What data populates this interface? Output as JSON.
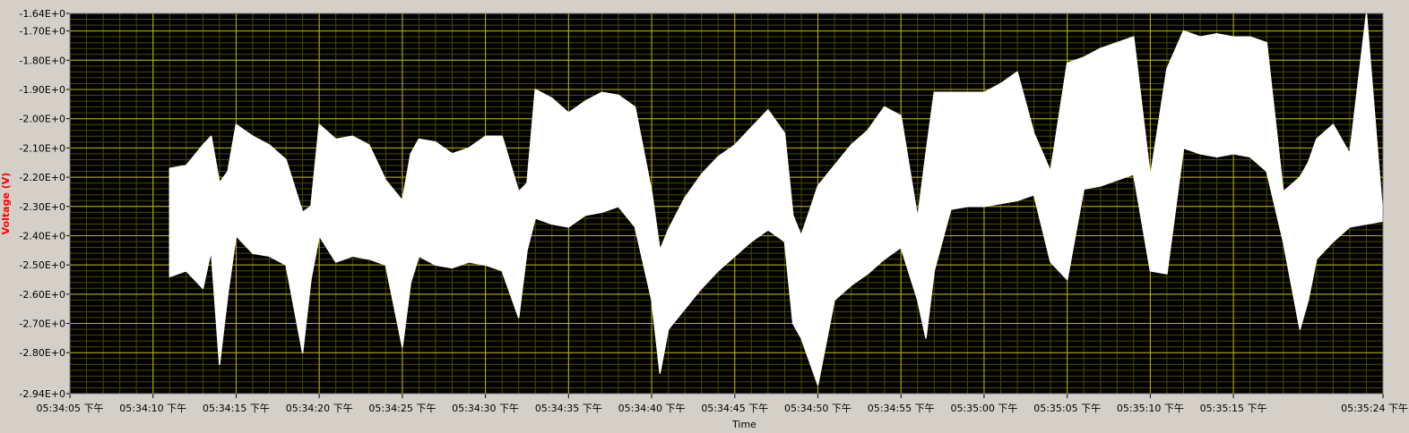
{
  "colors": {
    "plot_bg": "#000000",
    "major_grid": "#b8b800",
    "minor_grid": "#4a4a00",
    "trace": "#ffffff",
    "frame_bg": "#d4d0c8",
    "ylabel": "#ff0000",
    "text": "#000000"
  },
  "chart_data": {
    "type": "area",
    "title": "",
    "xlabel": "Time",
    "ylabel": "Voltage (V)",
    "xlim": [
      "05:34:05",
      "05:35:24"
    ],
    "ylim": [
      -2.94,
      -1.64
    ],
    "grid": true,
    "legend": "none",
    "y_ticks": [
      {
        "value": -1.64,
        "label": "-1.64E+0"
      },
      {
        "value": -1.7,
        "label": "-1.70E+0"
      },
      {
        "value": -1.8,
        "label": "-1.80E+0"
      },
      {
        "value": -1.9,
        "label": "-1.90E+0"
      },
      {
        "value": -2.0,
        "label": "-2.00E+0"
      },
      {
        "value": -2.1,
        "label": "-2.10E+0"
      },
      {
        "value": -2.2,
        "label": "-2.20E+0"
      },
      {
        "value": -2.3,
        "label": "-2.30E+0"
      },
      {
        "value": -2.4,
        "label": "-2.40E+0"
      },
      {
        "value": -2.5,
        "label": "-2.50E+0"
      },
      {
        "value": -2.6,
        "label": "-2.60E+0"
      },
      {
        "value": -2.7,
        "label": "-2.70E+0"
      },
      {
        "value": -2.8,
        "label": "-2.80E+0"
      },
      {
        "value": -2.94,
        "label": "-2.94E+0"
      }
    ],
    "x_ticks": [
      {
        "value": "05:34:05",
        "label": "05:34:05 下午"
      },
      {
        "value": "05:34:10",
        "label": "05:34:10 下午"
      },
      {
        "value": "05:34:15",
        "label": "05:34:15 下午"
      },
      {
        "value": "05:34:20",
        "label": "05:34:20 下午"
      },
      {
        "value": "05:34:25",
        "label": "05:34:25 下午"
      },
      {
        "value": "05:34:30",
        "label": "05:34:30 下午"
      },
      {
        "value": "05:34:35",
        "label": "05:34:35 下午"
      },
      {
        "value": "05:34:40",
        "label": "05:34:40 下午"
      },
      {
        "value": "05:34:45",
        "label": "05:34:45 下午"
      },
      {
        "value": "05:34:50",
        "label": "05:34:50 下午"
      },
      {
        "value": "05:34:55",
        "label": "05:34:55 下午"
      },
      {
        "value": "05:35:00",
        "label": "05:35:00 下午"
      },
      {
        "value": "05:35:05",
        "label": "05:35:05 下午"
      },
      {
        "value": "05:35:10",
        "label": "05:35:10 下午"
      },
      {
        "value": "05:35:15",
        "label": "05:35:15 下午"
      },
      {
        "value": "05:35:24",
        "label": "05:35:24 下午"
      }
    ],
    "series": [
      {
        "x": [
          "05:34:11",
          "05:34:12",
          "05:34:13",
          "05:34:13.5",
          "05:34:14",
          "05:34:14.5",
          "05:34:15",
          "05:34:16",
          "05:34:17",
          "05:34:18",
          "05:34:19",
          "05:34:19.5",
          "05:34:20",
          "05:34:21",
          "05:34:22",
          "05:34:23",
          "05:34:24",
          "05:34:25",
          "05:34:25.5",
          "05:34:26",
          "05:34:27",
          "05:34:28",
          "05:34:29",
          "05:34:30",
          "05:34:31",
          "05:34:32",
          "05:34:32.5",
          "05:34:33",
          "05:34:34",
          "05:34:35",
          "05:34:36",
          "05:34:37",
          "05:34:38",
          "05:34:39",
          "05:34:40",
          "05:34:40.5",
          "05:34:41",
          "05:34:42",
          "05:34:43",
          "05:34:44",
          "05:34:45",
          "05:34:46",
          "05:34:47",
          "05:34:48",
          "05:34:48.5",
          "05:34:49",
          "05:34:50",
          "05:34:51",
          "05:34:52",
          "05:34:53",
          "05:34:54",
          "05:34:55",
          "05:34:56",
          "05:34:56.5",
          "05:34:57",
          "05:34:58",
          "05:34:59",
          "05:35:00",
          "05:35:01",
          "05:35:02",
          "05:35:03",
          "05:35:04",
          "05:35:05",
          "05:35:06",
          "05:35:07",
          "05:35:08",
          "05:35:09",
          "05:35:10",
          "05:35:11",
          "05:35:12",
          "05:35:13",
          "05:35:14",
          "05:35:15",
          "05:35:16",
          "05:35:17",
          "05:35:18",
          "05:35:19",
          "05:35:19.5",
          "05:35:20",
          "05:35:21",
          "05:35:22",
          "05:35:23",
          "05:35:24"
        ],
        "upper": [
          -2.17,
          -2.16,
          -2.09,
          -2.06,
          -2.22,
          -2.18,
          -2.02,
          -2.06,
          -2.09,
          -2.14,
          -2.32,
          -2.3,
          -2.02,
          -2.07,
          -2.06,
          -2.09,
          -2.21,
          -2.28,
          -2.12,
          -2.07,
          -2.08,
          -2.12,
          -2.1,
          -2.06,
          -2.06,
          -2.25,
          -2.22,
          -1.9,
          -1.93,
          -1.98,
          -1.94,
          -1.91,
          -1.92,
          -1.96,
          -2.25,
          -2.45,
          -2.38,
          -2.27,
          -2.19,
          -2.13,
          -2.09,
          -2.03,
          -1.97,
          -2.05,
          -2.33,
          -2.4,
          -2.23,
          -2.16,
          -2.09,
          -2.04,
          -1.96,
          -1.99,
          -2.34,
          -2.12,
          -1.91,
          -1.91,
          -1.91,
          -1.91,
          -1.88,
          -1.84,
          -2.05,
          -2.18,
          -1.81,
          -1.79,
          -1.76,
          -1.74,
          -1.72,
          -2.2,
          -1.83,
          -1.7,
          -1.72,
          -1.71,
          -1.72,
          -1.72,
          -1.74,
          -2.25,
          -2.2,
          -2.15,
          -2.07,
          -2.02,
          -2.12,
          -1.64,
          -2.34
        ],
        "lower": [
          -2.54,
          -2.52,
          -2.58,
          -2.45,
          -2.84,
          -2.6,
          -2.4,
          -2.46,
          -2.47,
          -2.5,
          -2.8,
          -2.55,
          -2.4,
          -2.49,
          -2.47,
          -2.48,
          -2.5,
          -2.78,
          -2.56,
          -2.47,
          -2.5,
          -2.51,
          -2.49,
          -2.5,
          -2.52,
          -2.68,
          -2.45,
          -2.34,
          -2.36,
          -2.37,
          -2.33,
          -2.32,
          -2.3,
          -2.37,
          -2.62,
          -2.87,
          -2.72,
          -2.65,
          -2.58,
          -2.52,
          -2.47,
          -2.42,
          -2.38,
          -2.42,
          -2.7,
          -2.75,
          -2.91,
          -2.62,
          -2.57,
          -2.53,
          -2.48,
          -2.44,
          -2.62,
          -2.75,
          -2.52,
          -2.31,
          -2.3,
          -2.3,
          -2.29,
          -2.28,
          -2.26,
          -2.49,
          -2.55,
          -2.24,
          -2.23,
          -2.21,
          -2.19,
          -2.52,
          -2.53,
          -2.1,
          -2.12,
          -2.13,
          -2.12,
          -2.13,
          -2.18,
          -2.42,
          -2.72,
          -2.62,
          -2.48,
          -2.42,
          -2.37,
          -2.36,
          -2.35
        ]
      }
    ]
  }
}
